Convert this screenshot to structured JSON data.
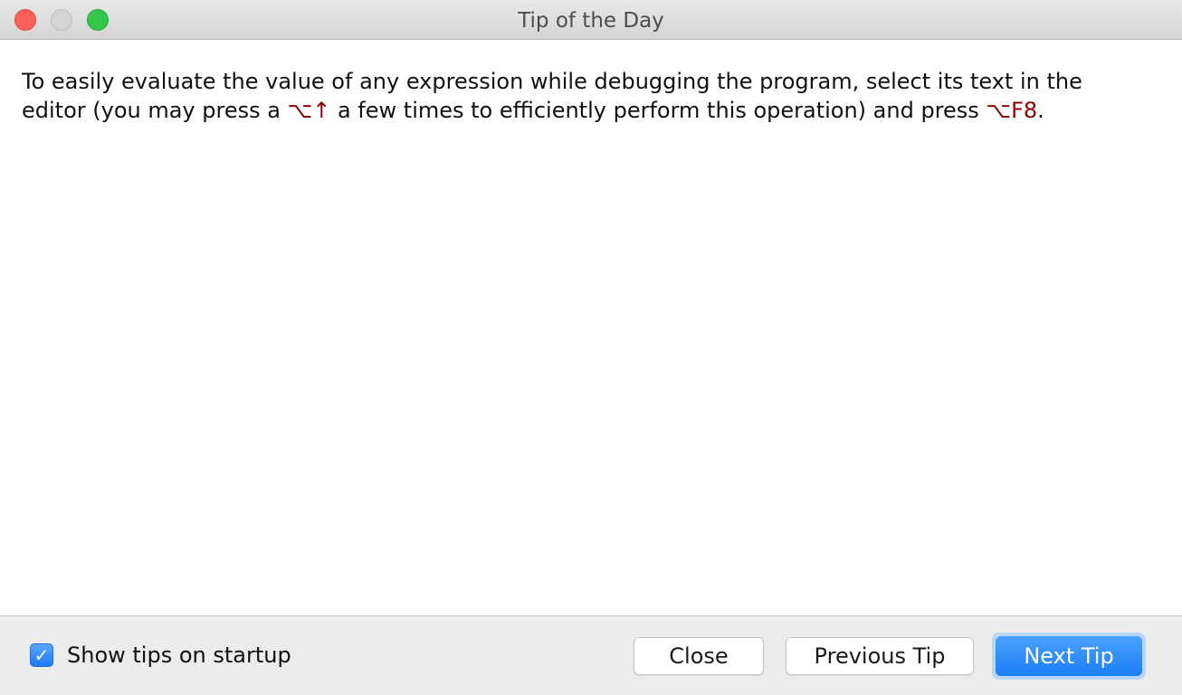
{
  "window": {
    "title": "Tip of the Day"
  },
  "tip": {
    "part1": "To easily evaluate the value of any expression while debugging the program, select its text in the editor (you may press a ",
    "shortcut1": "⌥↑",
    "part2": " a few times to efficiently perform this operation) and press ",
    "shortcut2": "⌥F8",
    "part3": "."
  },
  "footer": {
    "checkbox_label": "Show tips on startup",
    "checkbox_checked": true,
    "checkbox_glyph": "✓",
    "close_label": "Close",
    "previous_label": "Previous Tip",
    "next_label": "Next Tip"
  },
  "colors": {
    "accent": "#1a7ff5",
    "shortcut": "#8b0000"
  }
}
